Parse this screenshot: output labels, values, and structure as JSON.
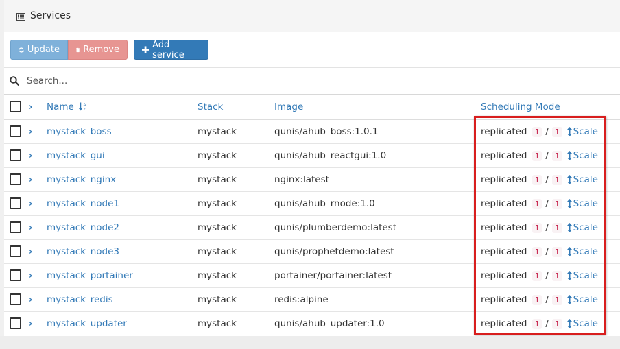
{
  "panel": {
    "title": "Services",
    "title_icon": "list-icon"
  },
  "toolbar": {
    "update_label": "Update",
    "update_icon": "refresh-icon",
    "remove_label": "Remove",
    "remove_icon": "trash-icon",
    "add_label": "Add service",
    "add_icon": "plus-icon"
  },
  "search": {
    "placeholder": "Search...",
    "icon": "search-icon"
  },
  "table": {
    "headers": {
      "name": "Name",
      "name_sort_icon": "sort-alpha-asc-icon",
      "stack": "Stack",
      "image": "Image",
      "scheduling": "Scheduling Mode"
    },
    "rows": [
      {
        "name": "mystack_boss",
        "stack": "mystack",
        "image": "qunis/ahub_boss:1.0.1",
        "mode": "replicated",
        "running": "1",
        "sep": "/",
        "desired": "1",
        "scale": "Scale"
      },
      {
        "name": "mystack_gui",
        "stack": "mystack",
        "image": "qunis/ahub_reactgui:1.0",
        "mode": "replicated",
        "running": "1",
        "sep": "/",
        "desired": "1",
        "scale": "Scale"
      },
      {
        "name": "mystack_nginx",
        "stack": "mystack",
        "image": "nginx:latest",
        "mode": "replicated",
        "running": "1",
        "sep": "/",
        "desired": "1",
        "scale": "Scale"
      },
      {
        "name": "mystack_node1",
        "stack": "mystack",
        "image": "qunis/ahub_rnode:1.0",
        "mode": "replicated",
        "running": "1",
        "sep": "/",
        "desired": "1",
        "scale": "Scale"
      },
      {
        "name": "mystack_node2",
        "stack": "mystack",
        "image": "qunis/plumberdemo:latest",
        "mode": "replicated",
        "running": "1",
        "sep": "/",
        "desired": "1",
        "scale": "Scale"
      },
      {
        "name": "mystack_node3",
        "stack": "mystack",
        "image": "qunis/prophetdemo:latest",
        "mode": "replicated",
        "running": "1",
        "sep": "/",
        "desired": "1",
        "scale": "Scale"
      },
      {
        "name": "mystack_portainer",
        "stack": "mystack",
        "image": "portainer/portainer:latest",
        "mode": "replicated",
        "running": "1",
        "sep": "/",
        "desired": "1",
        "scale": "Scale"
      },
      {
        "name": "mystack_redis",
        "stack": "mystack",
        "image": "redis:alpine",
        "mode": "replicated",
        "running": "1",
        "sep": "/",
        "desired": "1",
        "scale": "Scale"
      },
      {
        "name": "mystack_updater",
        "stack": "mystack",
        "image": "qunis/ahub_updater:1.0",
        "mode": "replicated",
        "running": "1",
        "sep": "/",
        "desired": "1",
        "scale": "Scale"
      }
    ]
  },
  "colors": {
    "link": "#337ab7",
    "update_button": "#7fb1da",
    "remove_button": "#e79592",
    "add_button": "#337ab7",
    "badge_text": "#c7254e",
    "highlight_box": "#d81e1e"
  }
}
